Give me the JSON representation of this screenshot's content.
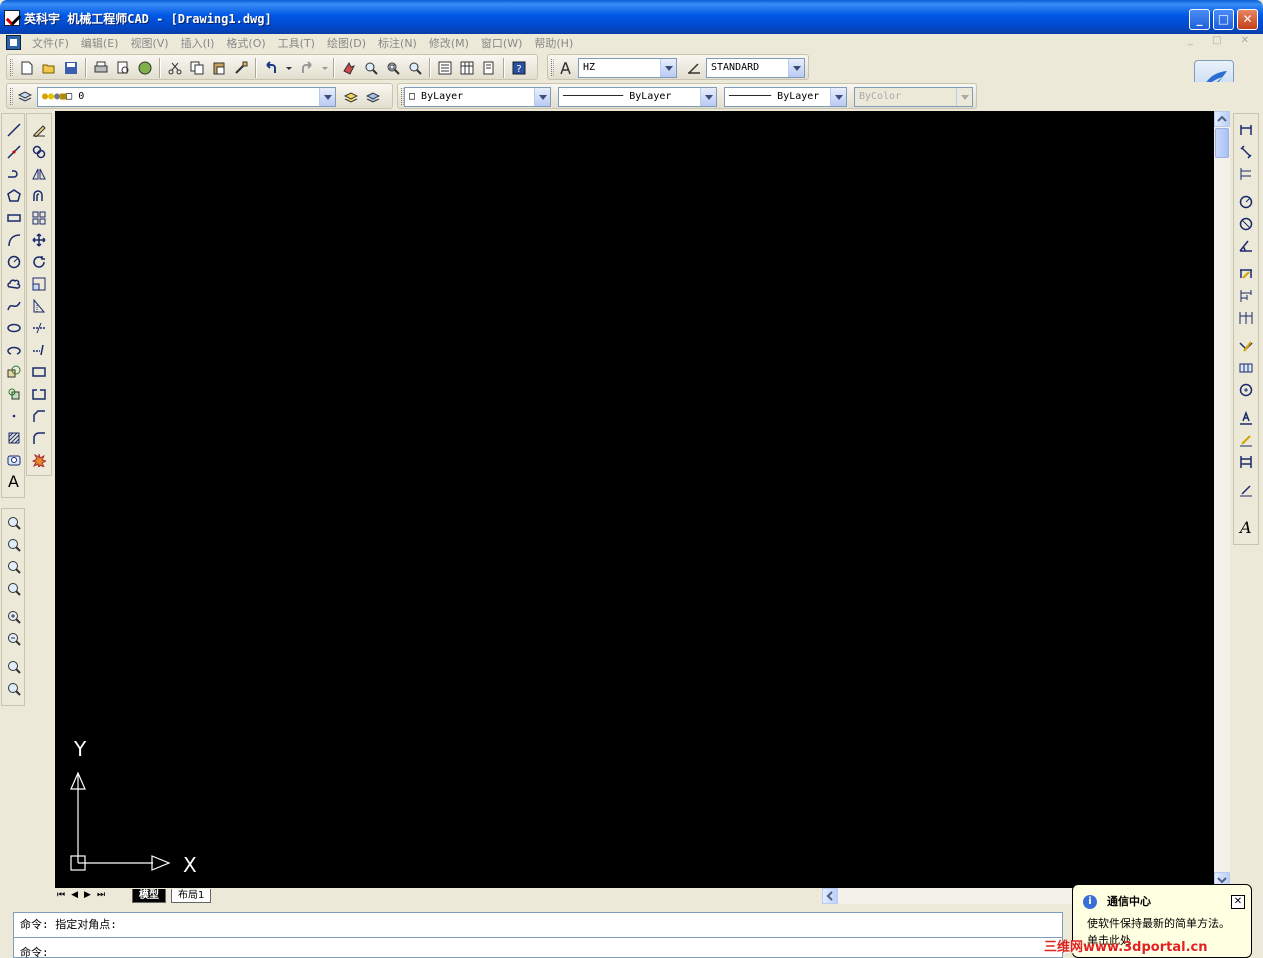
{
  "window": {
    "title": "英科宇 机械工程师CAD - [Drawing1.dwg]",
    "controls": {
      "minimize": "_",
      "maximize": "□",
      "close": "✕"
    }
  },
  "menu": {
    "items": [
      "文件(F)",
      "编辑(E)",
      "视图(V)",
      "插入(I)",
      "格式(O)",
      "工具(T)",
      "绘图(D)",
      "标注(N)",
      "修改(M)",
      "窗口(W)",
      "帮助(H)"
    ],
    "mdi_controls": "_ □ ✕"
  },
  "styles_toolbar": {
    "text_style": "HZ",
    "dim_style": "STANDARD"
  },
  "properties_toolbar": {
    "layer": "0",
    "color": "ByLayer",
    "linetype": "ByLayer",
    "lineweight": "ByLayer",
    "plotstyle": "ByColor"
  },
  "draw_toolbar": {
    "text_tool": "A"
  },
  "dimension_toolbar": {
    "text_tool": "A"
  },
  "ucs": {
    "x_label": "X",
    "y_label": "Y"
  },
  "tabs": {
    "model": "模型",
    "layout1": "布局1"
  },
  "command": {
    "history": "命令: 指定对角点:",
    "prompt": "命令:"
  },
  "notification": {
    "title": "通信中心",
    "message": "使软件保持最新的简单方法。",
    "link": "单击此处",
    "info_icon": "i",
    "close": "✕"
  },
  "watermark": "三维网www.3dportal.cn",
  "colors": {
    "titlebar": "#0058e6",
    "canvas": "#000000",
    "chrome": "#ece9d8",
    "watermark": "#e0231b"
  }
}
